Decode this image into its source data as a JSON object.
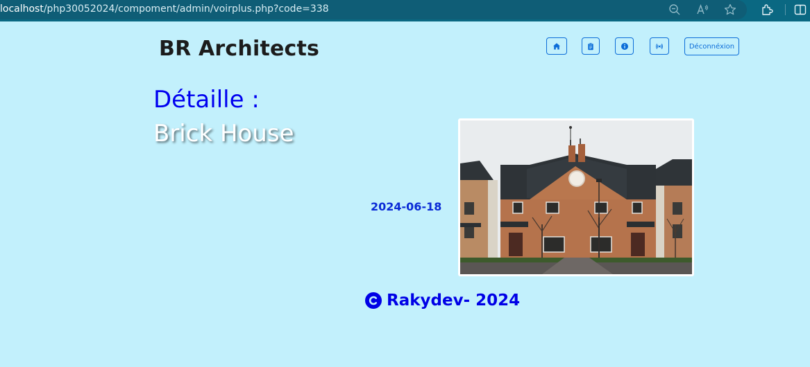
{
  "browser": {
    "url_host": "localhost",
    "url_path": "/php30052024/compoment/admin/voirplus.php?code=338",
    "icons": [
      "zoom-out-icon",
      "read-aloud-icon",
      "favorite-star-icon",
      "extensions-icon",
      "split-screen-icon"
    ]
  },
  "header": {
    "title": "BR Architects",
    "nav": [
      {
        "name": "home",
        "icon": "home-icon"
      },
      {
        "name": "projects",
        "icon": "clipboard-icon"
      },
      {
        "name": "info",
        "icon": "info-icon"
      },
      {
        "name": "contact",
        "icon": "broadcast-icon"
      }
    ],
    "logout_label": "Déconnéxion"
  },
  "detail": {
    "heading": "Détaille :",
    "project_name": "Brick House",
    "date": "2024-06-18",
    "image": "house-photo"
  },
  "footer": {
    "text": "Rakydev- 2024",
    "icon": "copyright-icon"
  },
  "colors": {
    "page_background": "#c2f0fc",
    "browser_bar": "#0a6882",
    "heading_blue": "#0000f0",
    "button_blue": "#0b6cd8"
  }
}
